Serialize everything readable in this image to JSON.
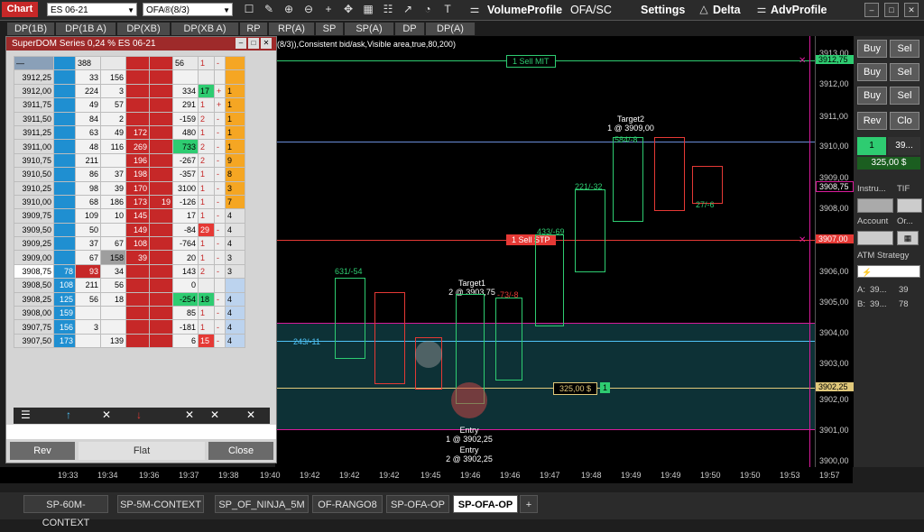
{
  "toolbar": {
    "chart_label": "Chart",
    "instrument": "ES 06-21",
    "indicator": "OFA®(8/3)",
    "volumeprofile": "VolumeProfile",
    "ofa_sc": "OFA/SC",
    "settings": "Settings",
    "delta": "Delta",
    "advprofile": "AdvProfile"
  },
  "dom_tabs": [
    "DP(1B)",
    "DP(1B A)",
    "DP(XB)",
    "DP(XB A)",
    "RP",
    "RP(A)",
    "SP",
    "SP(A)",
    "DP",
    "DP(A)"
  ],
  "chart": {
    "header": "(8/3)),Consistent bid/ask,Visible area,true,80,200)",
    "orders": {
      "sell_mit": "1 Sell MIT",
      "sell_stp": "1 Sell STP",
      "pnl": "325,00 $",
      "pnl_qty": "1"
    },
    "annotations": {
      "target1_title": "Target1",
      "target1_val": "2 @ 3903,75",
      "target2_title": "Target2",
      "target2_val": "1 @ 3909,00",
      "entry1_title": "Entry",
      "entry1_val": "1 @ 3902,25",
      "entry2_title": "Entry",
      "entry2_val": "2 @ 3902,25"
    },
    "deltas": [
      "631/-54",
      "433/-69",
      "221/-32",
      "584/-8",
      "-73/-8",
      "243/-11",
      "27/-6"
    ],
    "price_axis": [
      "3913,00",
      "3912,75",
      "3912,00",
      "3911,00",
      "3910,00",
      "3909,00",
      "3908,75",
      "3908,00",
      "3907,00",
      "3906,00",
      "3905,00",
      "3904,00",
      "3903,00",
      "3902,25",
      "3902,00",
      "3901,00",
      "3900,00"
    ],
    "time_axis": [
      "19:33",
      "19:34",
      "19:36",
      "19:37",
      "19:38",
      "19:40",
      "19:42",
      "19:42",
      "19:42",
      "19:45",
      "19:46",
      "19:46",
      "19:47",
      "19:48",
      "19:49",
      "19:49",
      "19:50",
      "19:50",
      "19:53",
      "19:57"
    ]
  },
  "superdom": {
    "title": "SuperDOM Series 0,24 % ES 06-21",
    "rows": [
      [
        "3912,25",
        "",
        "33",
        "156",
        "",
        "",
        "",
        "",
        "",
        ""
      ],
      [
        "3912,00",
        "",
        "224",
        "3",
        "",
        "",
        "334",
        "17",
        "+",
        "1"
      ],
      [
        "3911,75",
        "",
        "49",
        "57",
        "",
        "",
        "291",
        "1",
        "+",
        "1"
      ],
      [
        "3911,50",
        "",
        "84",
        "2",
        "",
        "",
        "-159",
        "2",
        "-",
        "1"
      ],
      [
        "3911,25",
        "",
        "63",
        "49",
        "172",
        "",
        "480",
        "1",
        "-",
        "1"
      ],
      [
        "3911,00",
        "",
        "48",
        "116",
        "269",
        "",
        "733",
        "2",
        "-",
        "1"
      ],
      [
        "3910,75",
        "",
        "211",
        "",
        "196",
        "",
        "-267",
        "2",
        "-",
        "9"
      ],
      [
        "3910,50",
        "",
        "86",
        "37",
        "198",
        "",
        "-357",
        "1",
        "-",
        "8"
      ],
      [
        "3910,25",
        "",
        "98",
        "39",
        "170",
        "",
        "3100",
        "1",
        "-",
        "3"
      ],
      [
        "3910,00",
        "",
        "68",
        "186",
        "173",
        "19",
        "-126",
        "1",
        "-",
        "7"
      ],
      [
        "3909,75",
        "",
        "109",
        "10",
        "145",
        "",
        "17",
        "1",
        "-",
        "4"
      ],
      [
        "3909,50",
        "",
        "50",
        "",
        "149",
        "",
        "-84",
        "29",
        "-",
        "4"
      ],
      [
        "3909,25",
        "",
        "37",
        "67",
        "108",
        "",
        "-764",
        "1",
        "-",
        "4"
      ],
      [
        "3909,00",
        "",
        "67",
        "158",
        "39",
        "",
        "20",
        "1",
        "-",
        "3"
      ],
      [
        "3908,75",
        "78",
        "93",
        "34",
        "",
        "",
        "143",
        "2",
        "-",
        "3"
      ],
      [
        "3908,50",
        "108",
        "211",
        "56",
        "",
        "",
        "0",
        "",
        "",
        ""
      ],
      [
        "3908,25",
        "125",
        "56",
        "18",
        "",
        "",
        "-254",
        "18",
        "-",
        "4"
      ],
      [
        "3908,00",
        "159",
        "",
        "",
        "",
        "",
        "85",
        "1",
        "-",
        "4"
      ],
      [
        "3907,75",
        "156",
        "3",
        "",
        "",
        "",
        "-181",
        "1",
        "-",
        "4"
      ],
      [
        "3907,50",
        "173",
        "",
        "139",
        "",
        "",
        "6",
        "15",
        "-",
        "4"
      ]
    ],
    "top_row_count": "388",
    "top_row_last": "56",
    "top_row_one": "1",
    "btn_rev": "Rev",
    "btn_flat": "Flat",
    "btn_close": "Close"
  },
  "right_panel": {
    "buy": "Buy",
    "sell": "Sel",
    "rev": "Rev",
    "close": "Clo",
    "qty": "1",
    "qty_val": "39...",
    "pnl": "325,00 $",
    "instrument_label": "Instru...",
    "tif_label": "TIF",
    "account_label": "Account",
    "order_label": "Or...",
    "atm_label": "ATM Strategy",
    "a_label": "A:",
    "a_val1": "39...",
    "a_val2": "39",
    "b_label": "B:",
    "b_val1": "39...",
    "b_val2": "78"
  },
  "bottom_tabs": [
    "SP-60M-CONTEXT",
    "SP-5M-CONTEXT",
    "SP_OF_NINJA_5M",
    "OF-RANGO8",
    "SP-OFA-OP",
    "SP-OFA-OP",
    "+"
  ]
}
